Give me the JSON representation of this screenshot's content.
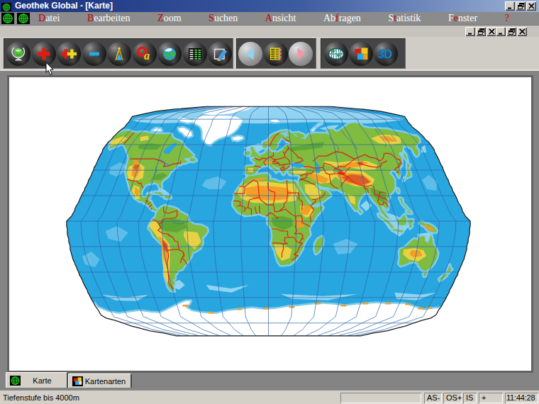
{
  "window": {
    "title": "Geothek Global - [Karte]",
    "app_icon": "globe-grid-icon"
  },
  "titlebar": {
    "buttons": [
      {
        "name": "minimize",
        "icon": "minimize-icon"
      },
      {
        "name": "restore",
        "icon": "restore-icon"
      },
      {
        "name": "close",
        "icon": "close-icon"
      }
    ]
  },
  "menubar": {
    "icons": [
      "globe-grid-icon",
      "globe-grid-icon"
    ],
    "items": [
      {
        "label": "Datei",
        "hot": 0
      },
      {
        "label": "Bearbeiten",
        "hot": 0
      },
      {
        "label": "Zoom",
        "hot": 0
      },
      {
        "label": "Suchen",
        "hot": 0
      },
      {
        "label": "Ansicht",
        "hot": 0
      },
      {
        "label": "Abfragen",
        "hot": 2
      },
      {
        "label": "Statistik",
        "hot": 1
      },
      {
        "label": "Fenster",
        "hot": 1
      },
      {
        "label": "?",
        "hot": 0
      }
    ],
    "hotkey_color": "#c00000"
  },
  "mdi_bar": {
    "button_groups": [
      [
        {
          "name": "minimize",
          "icon": "minimize-icon"
        },
        {
          "name": "restore",
          "icon": "restore-icon"
        },
        {
          "name": "close",
          "icon": "close-icon"
        }
      ],
      [
        {
          "name": "minimize",
          "icon": "minimize-icon"
        },
        {
          "name": "restore",
          "icon": "restore-icon"
        },
        {
          "name": "close",
          "icon": "close-icon"
        }
      ]
    ]
  },
  "toolbar": {
    "groups": [
      {
        "buttons": [
          {
            "name": "globe-home",
            "icon": "globe-stand-icon",
            "style": "dark"
          },
          {
            "name": "zoom-in",
            "icon": "zoom-in-icon",
            "style": "dark"
          },
          {
            "name": "zoom-in-strong",
            "icon": "zoom-in-strong-icon",
            "style": "dark"
          },
          {
            "name": "zoom-out",
            "icon": "zoom-out-icon",
            "style": "dark"
          },
          {
            "name": "measure",
            "icon": "compass-icon",
            "style": "dark"
          },
          {
            "name": "search-name",
            "icon": "search-a-icon",
            "style": "dark"
          },
          {
            "name": "earth",
            "icon": "earth-icon",
            "style": "dark"
          },
          {
            "name": "data-table",
            "icon": "data-table-icon",
            "style": "dark"
          },
          {
            "name": "map-sheet",
            "icon": "map-sheet-icon",
            "style": "dark"
          }
        ]
      },
      {
        "buttons": [
          {
            "name": "nav-back",
            "icon": "nav-back-icon",
            "style": "light"
          },
          {
            "name": "data-sheet",
            "icon": "data-sheet-icon",
            "style": "dark"
          },
          {
            "name": "nav-forward",
            "icon": "nav-forward-icon",
            "style": "light"
          }
        ]
      },
      {
        "buttons": [
          {
            "name": "globe-view",
            "icon": "globe-flat-icon",
            "style": "dark"
          },
          {
            "name": "map-types",
            "icon": "map-types-icon",
            "style": "dark"
          },
          {
            "name": "view-3d",
            "icon": "view-3d-icon",
            "style": "dark"
          }
        ]
      }
    ]
  },
  "tabs": [
    {
      "label": "Karte",
      "icon": "globe-grid-icon",
      "active": true
    },
    {
      "label": "Kartenarten",
      "icon": "map-types-icon",
      "active": false
    }
  ],
  "statusbar": {
    "message": "Tiefenstufe bis 4000m",
    "panels": [
      "",
      "AS-",
      "OS+",
      "IS",
      "+",
      "11:44:28"
    ]
  },
  "colors": {
    "titlebar_gradient_left": "#17307d",
    "titlebar_gradient_right": "#9bb1d4",
    "menubar_bg": "#8b8b8b",
    "ocean": "#28a7e0",
    "land": "#7fbc40",
    "hotkey_red": "#c00000"
  }
}
